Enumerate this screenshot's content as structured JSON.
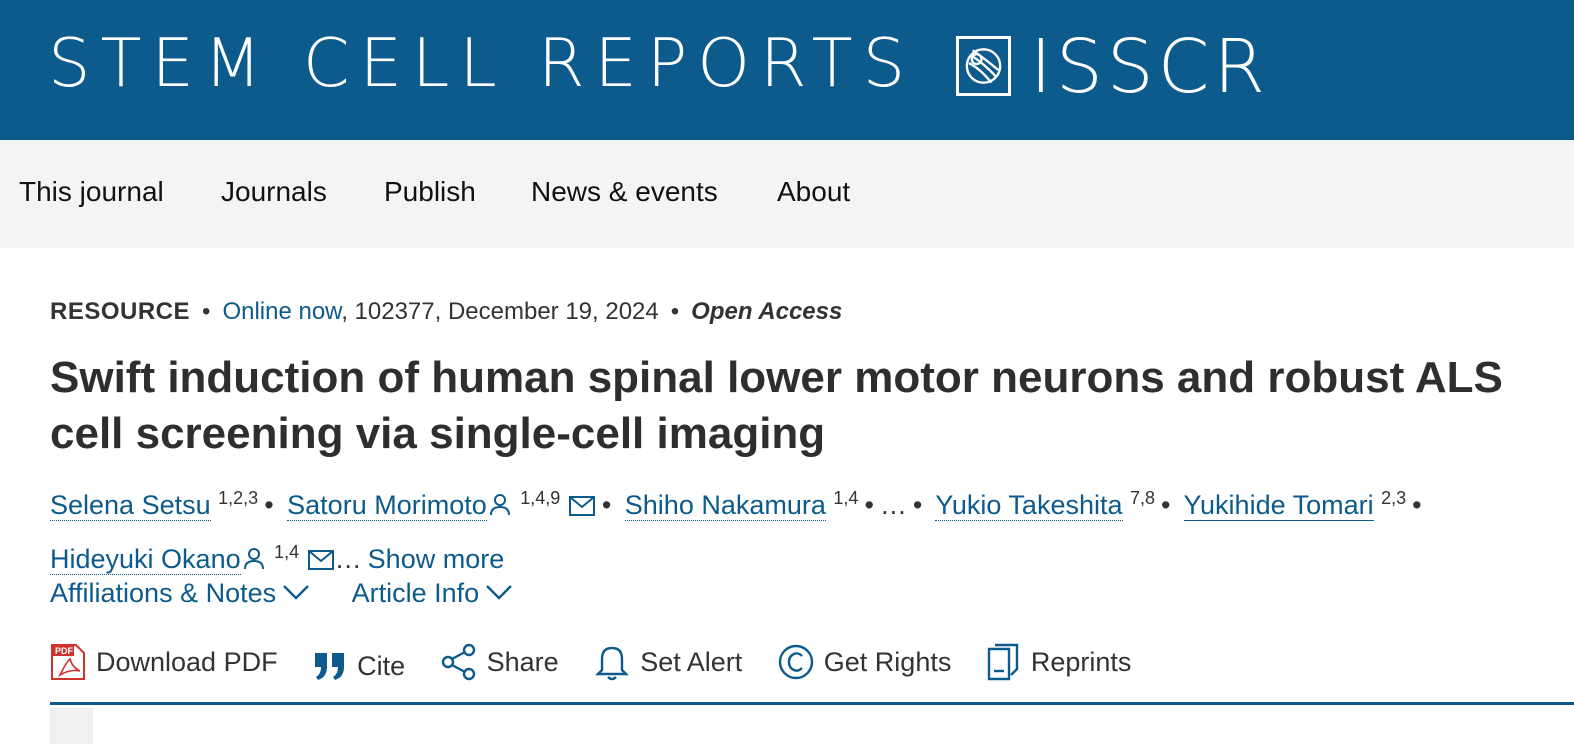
{
  "banner": {
    "journal_name": "STEM CELL REPORTS",
    "society": "ISSCR",
    "background_color": "#0d5a8c"
  },
  "nav": {
    "items": [
      "This journal",
      "Journals",
      "Publish",
      "News & events",
      "About"
    ]
  },
  "article": {
    "type": "RESOURCE",
    "status_link": "Online now",
    "citation": ", 102377, December 19, 2024",
    "access": "Open Access",
    "title": "Swift induction of human spinal lower motor neurons and robust ALS cell screening via single-cell imaging",
    "authors": [
      {
        "name": "Selena Setsu",
        "aff": "1,2,3"
      },
      {
        "name": "Satoru Morimoto",
        "aff": "1,4,9"
      },
      {
        "name": "Shiho Nakamura",
        "aff": "1,4"
      },
      {
        "name": "Yukio Takeshita",
        "aff": "7,8"
      },
      {
        "name": "Yukihide Tomari",
        "aff": "2,3"
      },
      {
        "name": "Hideyuki Okano",
        "aff": "1,4"
      }
    ],
    "ellipsis": "…",
    "show_more": "Show more"
  },
  "expanders": {
    "affiliations": "Affiliations & Notes",
    "article_info": "Article Info"
  },
  "toolbar": {
    "download_pdf": "Download PDF",
    "cite": "Cite",
    "share": "Share",
    "set_alert": "Set Alert",
    "get_rights": "Get Rights",
    "reprints": "Reprints"
  },
  "icons": {
    "pdf": "pdf-icon",
    "quote": "quote-icon",
    "share": "share-icon",
    "bell": "bell-icon",
    "copyright": "copyright-icon",
    "reprints": "document-icon",
    "person": "person-icon",
    "mail": "mail-icon",
    "chevron": "chevron-down-icon"
  },
  "colors": {
    "link": "#0d5a8c",
    "pdf_red": "#d0312d"
  }
}
